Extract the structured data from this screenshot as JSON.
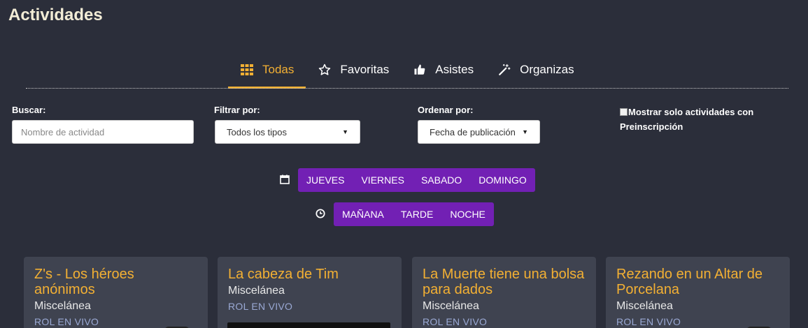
{
  "page": {
    "title": "Actividades"
  },
  "tabs": [
    {
      "label": "Todas",
      "icon": "grid-icon",
      "active": true
    },
    {
      "label": "Favoritas",
      "icon": "star-icon",
      "active": false
    },
    {
      "label": "Asistes",
      "icon": "thumbs-up-icon",
      "active": false
    },
    {
      "label": "Organizas",
      "icon": "magic-wand-icon",
      "active": false
    }
  ],
  "filters": {
    "search_label": "Buscar:",
    "search_placeholder": "Nombre de actividad",
    "search_value": "",
    "filter_label": "Filtrar por:",
    "filter_value": "Todos los tipos",
    "sort_label": "Ordenar por:",
    "sort_value": "Fecha de publicación",
    "preinscription_label": "Mostrar solo actividades con Preinscripción",
    "preinscription_checked": false
  },
  "days": {
    "icon": "calendar-icon",
    "items": [
      "JUEVES",
      "VIERNES",
      "SABADO",
      "DOMINGO"
    ]
  },
  "times": {
    "icon": "clock-icon",
    "items": [
      "MAÑANA",
      "TARDE",
      "NOCHE"
    ]
  },
  "cards": [
    {
      "title": "Z's - Los héroes anónimos",
      "category": "Miscelánea",
      "tag": "ROL EN VIVO"
    },
    {
      "title": "La cabeza de Tim",
      "category": "Miscelánea",
      "tag": "ROL EN VIVO"
    },
    {
      "title": "La Muerte tiene una bolsa para dados",
      "category": "Miscelánea",
      "tag": "ROL EN VIVO"
    },
    {
      "title": "Rezando en un Altar de Porcelana",
      "category": "Miscelánea",
      "tag": "ROL EN VIVO"
    }
  ],
  "colors": {
    "background": "#2b2e3a",
    "accent": "#f3b033",
    "button_group": "#7220b4",
    "card": "#3f4350",
    "tag": "#9aa9d4"
  }
}
